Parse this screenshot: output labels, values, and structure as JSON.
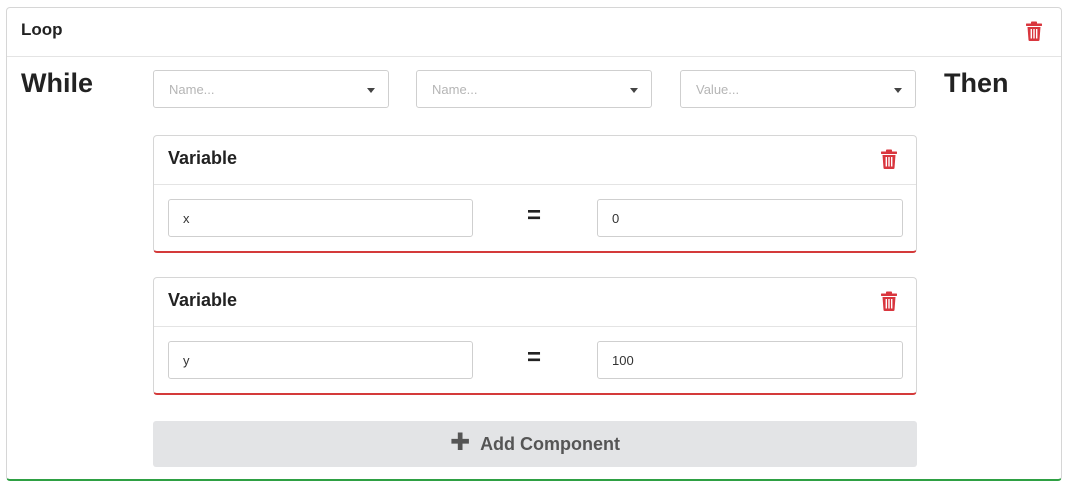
{
  "loop": {
    "title": "Loop",
    "while_label": "While",
    "then_label": "Then",
    "condition": {
      "left_placeholder": "Name...",
      "operator_placeholder": "Name...",
      "right_placeholder": "Value..."
    }
  },
  "variables": [
    {
      "title": "Variable",
      "name": "x",
      "operator": "=",
      "value": "0"
    },
    {
      "title": "Variable",
      "name": "y",
      "operator": "=",
      "value": "100"
    }
  ],
  "add_component": {
    "icon": "plus-icon",
    "label": "Add Component"
  },
  "colors": {
    "delete": "#d9363e",
    "loop_accent": "#2ea043",
    "variable_accent": "#d43a3a",
    "button_bg": "#e3e4e6"
  }
}
